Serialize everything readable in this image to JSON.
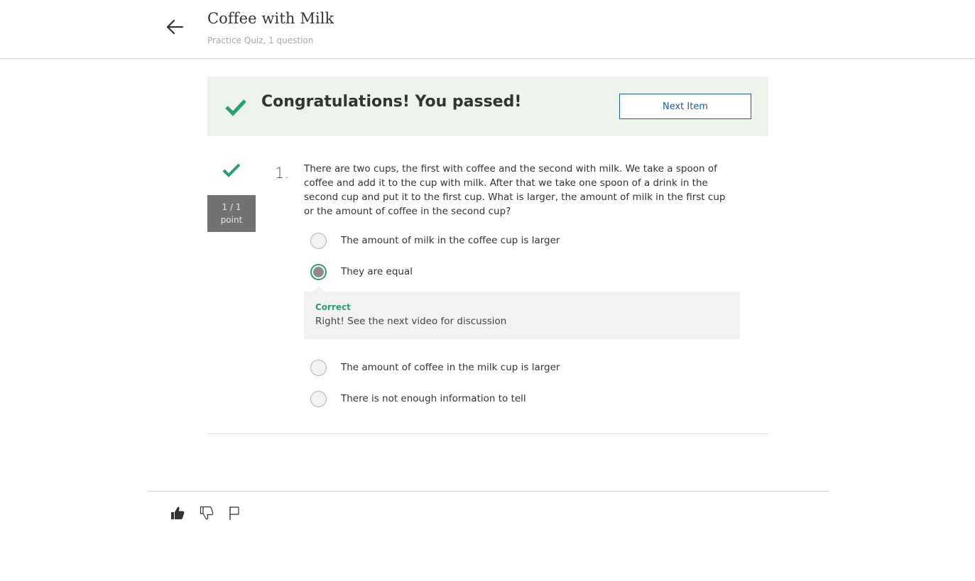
{
  "header": {
    "title": "Coffee with Milk",
    "subtitle": "Practice Quiz, 1 question",
    "back_icon": "arrow-left-icon"
  },
  "banner": {
    "message": "Congratulations! You passed!",
    "next_label": "Next Item",
    "icon": "checkmark-icon",
    "background_color": "#ecf4ec",
    "check_color": "#2a9e73"
  },
  "question": {
    "number": "1.",
    "text": "There are two cups, the first with coffee and the second with milk. We take a spoon of coffee and add it to the cup with milk. After that we take one spoon of a drink in the second cup and put it to the first cup. What is larger, the amount of milk in the first cup or the amount of coffee in the second cup?",
    "points_line1": "1 / 1",
    "points_line2": "point",
    "options": [
      {
        "label": "The amount of milk in the coffee cup is larger",
        "selected": false
      },
      {
        "label": "They are equal",
        "selected": true
      },
      {
        "label": "The amount of coffee in the milk cup is larger",
        "selected": false
      },
      {
        "label": "There is not enough information to tell",
        "selected": false
      }
    ],
    "feedback": {
      "status": "Correct",
      "text": "Right! See the next video for discussion",
      "status_color": "#2a9e73"
    }
  },
  "footer": {
    "icons": [
      "thumbs-up-icon",
      "thumbs-down-icon",
      "flag-icon"
    ]
  }
}
